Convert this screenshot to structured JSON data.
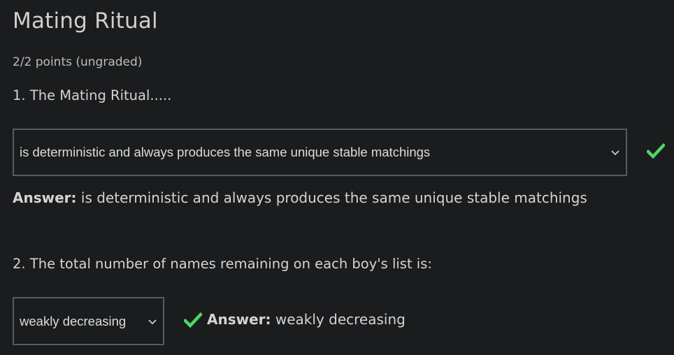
{
  "problem": {
    "title": "Mating Ritual",
    "points": "2/2 points (ungraded)"
  },
  "questions": [
    {
      "label": "1. The Mating Ritual.....",
      "selected": "is deterministic and always produces the same unique stable matchings",
      "answer_label": "Answer:",
      "answer_text": "is deterministic and always produces the same unique stable matchings",
      "status_icon": "checkmark-icon"
    },
    {
      "label": "2. The total number of names remaining on each boy's list is:",
      "selected": "weakly decreasing",
      "answer_label": "Answer:",
      "answer_text": "weakly decreasing",
      "status_icon": "checkmark-icon"
    }
  ],
  "colors": {
    "background": "#1b1c1e",
    "correct": "#4cd964",
    "select_border": "#5a5b5e"
  }
}
